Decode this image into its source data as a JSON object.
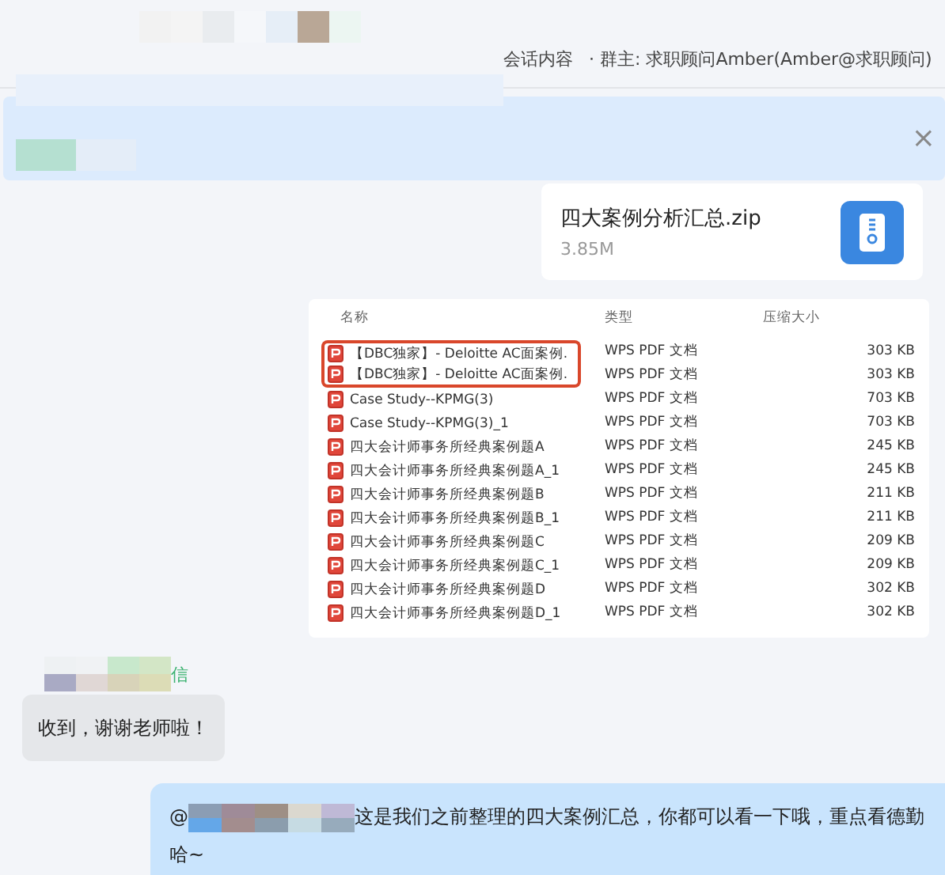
{
  "header": {
    "info": "会话内容",
    "owner": "· 群主: 求职顾问Amber(Amber@求职顾问)"
  },
  "banner": {
    "close": "×"
  },
  "file_card": {
    "name": "四大案例分析汇总.zip",
    "size": "3.85M"
  },
  "file_list": {
    "columns": [
      "名称",
      "类型",
      "压缩大小"
    ],
    "rows": [
      {
        "name": "【DBC独家】- Deloitte AC面案例.",
        "type": "WPS PDF 文档",
        "size": "303 KB",
        "highlighted": true
      },
      {
        "name": "【DBC独家】- Deloitte AC面案例.",
        "type": "WPS PDF 文档",
        "size": "303 KB",
        "highlighted": true
      },
      {
        "name": "Case Study--KPMG(3)",
        "type": "WPS PDF 文档",
        "size": "703 KB",
        "highlighted": false
      },
      {
        "name": "Case Study--KPMG(3)_1",
        "type": "WPS PDF 文档",
        "size": "703 KB",
        "highlighted": false
      },
      {
        "name": "四大会计师事务所经典案例题A",
        "type": "WPS PDF 文档",
        "size": "245 KB",
        "highlighted": false
      },
      {
        "name": "四大会计师事务所经典案例题A_1",
        "type": "WPS PDF 文档",
        "size": "245 KB",
        "highlighted": false
      },
      {
        "name": "四大会计师事务所经典案例题B",
        "type": "WPS PDF 文档",
        "size": "211 KB",
        "highlighted": false
      },
      {
        "name": "四大会计师事务所经典案例题B_1",
        "type": "WPS PDF 文档",
        "size": "211 KB",
        "highlighted": false
      },
      {
        "name": "四大会计师事务所经典案例题C",
        "type": "WPS PDF 文档",
        "size": "209 KB",
        "highlighted": false
      },
      {
        "name": "四大会计师事务所经典案例题C_1",
        "type": "WPS PDF 文档",
        "size": "209 KB",
        "highlighted": false
      },
      {
        "name": "四大会计师事务所经典案例题D",
        "type": "WPS PDF 文档",
        "size": "302 KB",
        "highlighted": false
      },
      {
        "name": "四大会计师事务所经典案例题D_1",
        "type": "WPS PDF 文档",
        "size": "302 KB",
        "highlighted": false
      }
    ]
  },
  "sender": {
    "source": "信"
  },
  "messages": [
    {
      "kind": "received",
      "text": "收到，谢谢老师啦！"
    },
    {
      "kind": "sent",
      "prefix": "@",
      "text": "这是我们之前整理的四大案例汇总，你都可以看一下哦，重点看德勤哈~"
    }
  ]
}
